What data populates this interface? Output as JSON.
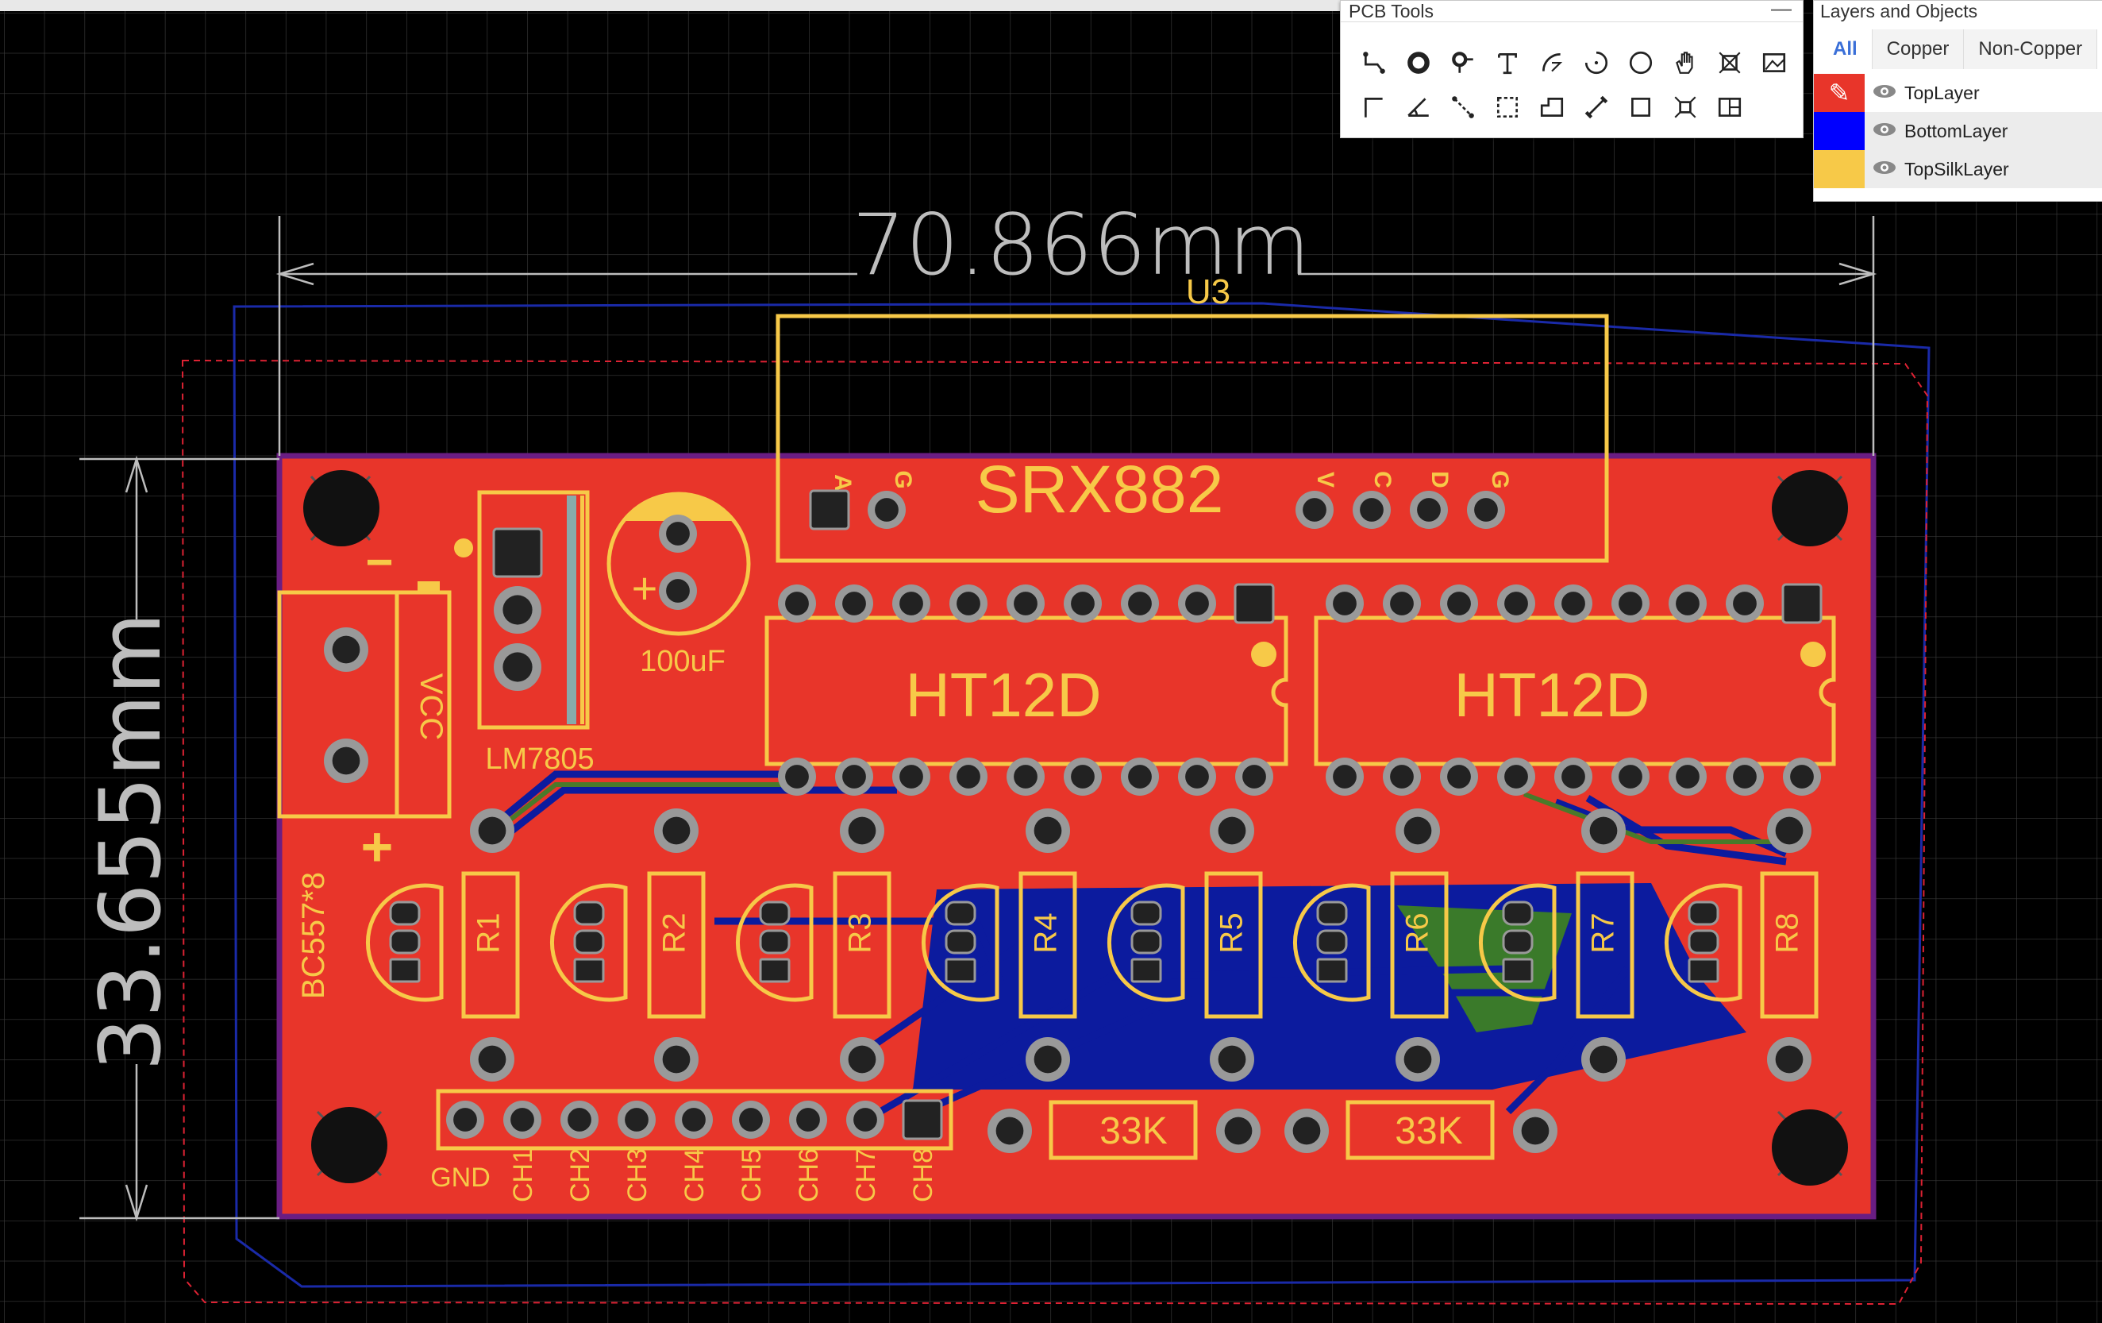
{
  "pcb_tools": {
    "title": "PCB Tools",
    "minimize": "—",
    "tools": [
      "track-tool-icon",
      "pad-tool-icon",
      "via-tool-icon",
      "text-tool-icon",
      "arc-tool-icon",
      "center-arc-tool-icon",
      "circle-tool-icon",
      "pan-tool-icon",
      "copper-area-tool-icon",
      "image-tool-icon",
      "polyline-tool-icon",
      "angle-tool-icon",
      "dimension-tool-icon",
      "rectangle-select-icon",
      "solid-region-icon",
      "connect-pad-icon",
      "rectangle-tool-icon",
      "canvas-origin-icon",
      "photo-view-icon"
    ]
  },
  "layers_panel": {
    "title": "Layers and Objects",
    "tabs": [
      "All",
      "Copper",
      "Non-Copper"
    ],
    "layers": [
      {
        "name": "TopLayer",
        "color": "#e8352a",
        "pencil": "✎"
      },
      {
        "name": "BottomLayer",
        "color": "#0000ff"
      },
      {
        "name": "TopSilkLayer",
        "color": "#f7c948"
      }
    ]
  },
  "pcb": {
    "width_dimension": "70.866mm",
    "height_dimension": "33.655mm",
    "colors": {
      "copper_top": "#e8352a",
      "copper_bottom": "#0c1b9e",
      "silk": "#f7c948",
      "outline": "#6a1d83",
      "bg": "#000000"
    },
    "labels": {
      "u3": "U3",
      "srx": "SRX882",
      "srx_pins_left": [
        "A",
        "G"
      ],
      "srx_pins_right": [
        "V",
        "C",
        "D",
        "G"
      ],
      "ic1": "HT12D",
      "ic2": "HT12D",
      "lm": "LM7805",
      "cap": "100uF",
      "cap_plus": "+",
      "vcc": "VCC",
      "minus": "−",
      "plus": "+",
      "bc": "BC557*8",
      "resistors": [
        "R1",
        "R2",
        "R3",
        "R4",
        "R5",
        "R6",
        "R7",
        "R8"
      ],
      "res_33k_1": "33K",
      "res_33k_2": "33K",
      "header": [
        "GND",
        "CH1",
        "CH2",
        "CH3",
        "CH4",
        "CH5",
        "CH6",
        "CH7",
        "CH8"
      ]
    }
  }
}
